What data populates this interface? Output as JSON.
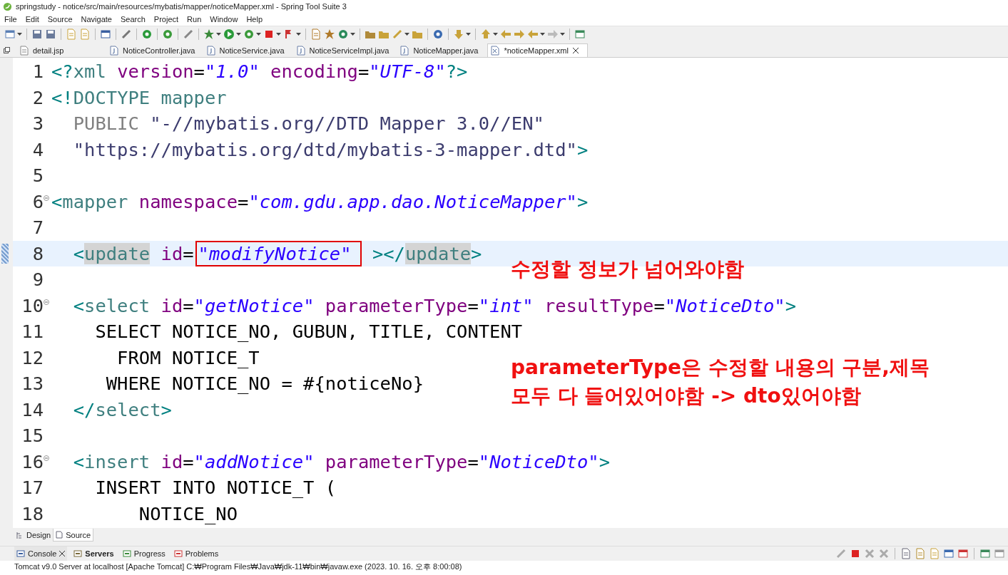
{
  "window": {
    "title": "springstudy - notice/src/main/resources/mybatis/mapper/noticeMapper.xml - Spring Tool Suite 3"
  },
  "menu": [
    "File",
    "Edit",
    "Source",
    "Navigate",
    "Search",
    "Project",
    "Run",
    "Window",
    "Help"
  ],
  "editor_tabs": [
    {
      "label": "detail.jsp",
      "kind": "page",
      "selected": false
    },
    {
      "label": "NoticeController.java",
      "kind": "class",
      "selected": false
    },
    {
      "label": "NoticeService.java",
      "kind": "class",
      "selected": false
    },
    {
      "label": "NoticeServiceImpl.java",
      "kind": "class",
      "selected": false
    },
    {
      "label": "NoticeMapper.java",
      "kind": "class",
      "selected": false
    },
    {
      "label": "*noticeMapper.xml",
      "kind": "markup",
      "selected": true
    }
  ],
  "code_lines": [
    {
      "number": "1",
      "foldable": false,
      "current": false,
      "tokens": [
        {
          "kind": "bracket",
          "text": "<?"
        },
        {
          "kind": "tag",
          "text": "xml"
        },
        {
          "kind": "attr",
          "text": " version"
        },
        {
          "kind": "eq",
          "text": "="
        },
        {
          "kind": "value",
          "text": "\"1.0\""
        },
        {
          "kind": "attr",
          "text": " encoding"
        },
        {
          "kind": "eq",
          "text": "="
        },
        {
          "kind": "value",
          "text": "\"UTF-8\""
        },
        {
          "kind": "bracket",
          "text": "?>"
        }
      ]
    },
    {
      "number": "2",
      "foldable": false,
      "current": false,
      "tokens": [
        {
          "kind": "bracket",
          "text": "<!"
        },
        {
          "kind": "tag",
          "text": "DOCTYPE mapper"
        }
      ]
    },
    {
      "number": "3",
      "foldable": false,
      "current": false,
      "tokens": [
        {
          "kind": "keyword",
          "text": "  PUBLIC "
        },
        {
          "kind": "doc_string",
          "text": "\"-//mybatis.org//DTD Mapper 3.0//EN\""
        }
      ]
    },
    {
      "number": "4",
      "foldable": false,
      "current": false,
      "tokens": [
        {
          "kind": "doc_string",
          "text": "  \"https://mybatis.org/dtd/mybatis-3-mapper.dtd\""
        },
        {
          "kind": "bracket",
          "text": ">"
        }
      ]
    },
    {
      "number": "5",
      "foldable": false,
      "current": false
    },
    {
      "number": "6",
      "foldable": true,
      "current": false,
      "tokens": [
        {
          "kind": "bracket",
          "text": "<"
        },
        {
          "kind": "tag",
          "text": "mapper"
        },
        {
          "kind": "attr",
          "text": " namespace"
        },
        {
          "kind": "eq",
          "text": "="
        },
        {
          "kind": "value",
          "text": "\"com.gdu.app.dao.NoticeMapper\""
        },
        {
          "kind": "bracket",
          "text": ">"
        }
      ]
    },
    {
      "number": "7",
      "foldable": false,
      "current": false
    },
    {
      "number": "8",
      "foldable": false,
      "current": true,
      "tokens": [
        {
          "kind": "bracket",
          "text": "  <"
        },
        {
          "kind": "tag_marked",
          "text": "update"
        },
        {
          "kind": "attr",
          "text": " id"
        },
        {
          "kind": "eq",
          "text": "="
        },
        {
          "kind": "value_boxed",
          "text": "\"modifyNotice\""
        },
        {
          "kind": "bracket",
          "text": " ></"
        },
        {
          "kind": "tag_marked",
          "text": "update"
        },
        {
          "kind": "bracket",
          "text": ">"
        }
      ]
    },
    {
      "number": "9",
      "foldable": false,
      "current": false
    },
    {
      "number": "10",
      "foldable": true,
      "current": false,
      "tokens": [
        {
          "kind": "bracket",
          "text": "  <"
        },
        {
          "kind": "tag",
          "text": "select"
        },
        {
          "kind": "attr",
          "text": " id"
        },
        {
          "kind": "eq",
          "text": "="
        },
        {
          "kind": "value",
          "text": "\"getNotice\""
        },
        {
          "kind": "attr",
          "text": " parameterType"
        },
        {
          "kind": "eq",
          "text": "="
        },
        {
          "kind": "value",
          "text": "\"int\""
        },
        {
          "kind": "attr",
          "text": " resultType"
        },
        {
          "kind": "eq",
          "text": "="
        },
        {
          "kind": "value",
          "text": "\"NoticeDto\""
        },
        {
          "kind": "bracket",
          "text": ">"
        }
      ]
    },
    {
      "number": "11",
      "foldable": false,
      "current": false,
      "tokens": [
        {
          "kind": "text",
          "text": "    SELECT NOTICE_NO, GUBUN, TITLE, CONTENT"
        }
      ]
    },
    {
      "number": "12",
      "foldable": false,
      "current": false,
      "tokens": [
        {
          "kind": "text",
          "text": "      FROM NOTICE_T"
        }
      ]
    },
    {
      "number": "13",
      "foldable": false,
      "current": false,
      "tokens": [
        {
          "kind": "text",
          "text": "     WHERE NOTICE_NO = #{noticeNo}"
        }
      ]
    },
    {
      "number": "14",
      "foldable": false,
      "current": false,
      "tokens": [
        {
          "kind": "bracket",
          "text": "  </"
        },
        {
          "kind": "tag",
          "text": "select"
        },
        {
          "kind": "bracket",
          "text": ">"
        }
      ]
    },
    {
      "number": "15",
      "foldable": false,
      "current": false
    },
    {
      "number": "16",
      "foldable": true,
      "current": false,
      "tokens": [
        {
          "kind": "bracket",
          "text": "  <"
        },
        {
          "kind": "tag",
          "text": "insert"
        },
        {
          "kind": "attr",
          "text": " id"
        },
        {
          "kind": "eq",
          "text": "="
        },
        {
          "kind": "value",
          "text": "\"addNotice\""
        },
        {
          "kind": "attr",
          "text": " parameterType"
        },
        {
          "kind": "eq",
          "text": "="
        },
        {
          "kind": "value",
          "text": "\"NoticeDto\""
        },
        {
          "kind": "bracket",
          "text": ">"
        }
      ]
    },
    {
      "number": "17",
      "foldable": false,
      "current": false,
      "tokens": [
        {
          "kind": "text",
          "text": "    INSERT INTO NOTICE_T ("
        }
      ]
    },
    {
      "number": "18",
      "foldable": false,
      "current": false,
      "tokens": [
        {
          "kind": "text",
          "text": "        NOTICE_NO"
        }
      ]
    }
  ],
  "annotations": [
    "수정할 정보가 넘어와야함",
    "parameterType은 수정할 내용의 구분,제목",
    "모두 다 들어있어야함 -> dto있어야함"
  ],
  "editor_mode_tabs": [
    {
      "label": "Design",
      "selected": false
    },
    {
      "label": "Source",
      "selected": true
    }
  ],
  "console_tabs": [
    {
      "label": "Console",
      "selected": true,
      "bold": false
    },
    {
      "label": "Servers",
      "selected": false,
      "bold": true
    },
    {
      "label": "Progress",
      "selected": false,
      "bold": false
    },
    {
      "label": "Problems",
      "selected": false,
      "bold": false
    }
  ],
  "console": {
    "text": "Tomcat v9.0 Server at localhost [Apache Tomcat] C:₩Program Files₩Java₩jdk-11₩bin₩javaw.exe  (2023. 10. 16. 오후 8:00:08)"
  }
}
